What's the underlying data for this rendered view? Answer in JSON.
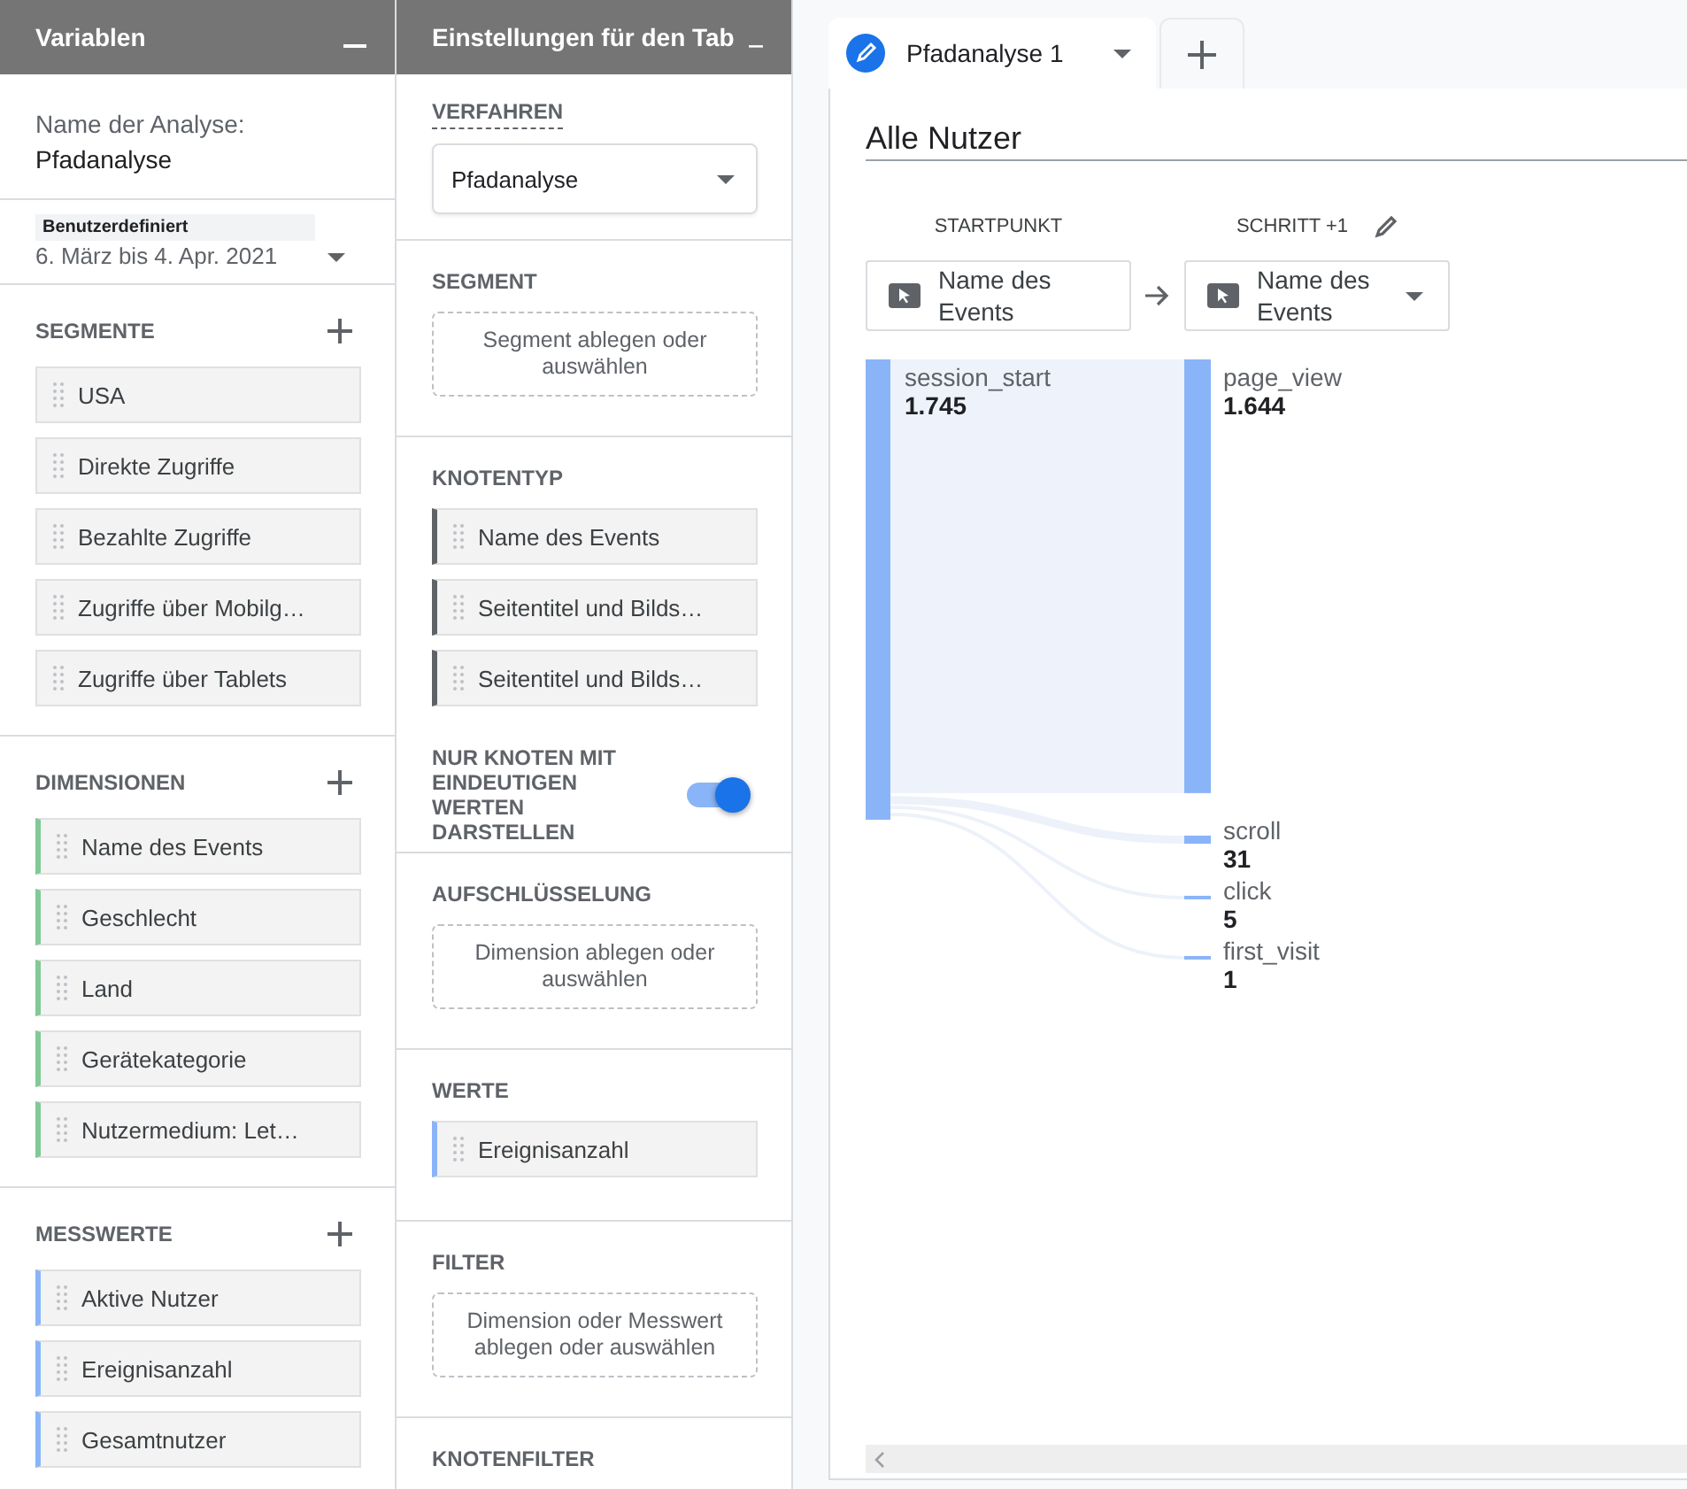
{
  "variables_panel": {
    "title": "Variablen",
    "analysis_name_label": "Name der Analyse:",
    "analysis_name": "Pfadanalyse",
    "date_range": {
      "label": "Benutzerdefiniert",
      "value": "6. März bis 4. Apr. 2021"
    },
    "segments": {
      "title": "SEGMENTE",
      "items": [
        "USA",
        "Direkte Zugriffe",
        "Bezahlte Zugriffe",
        "Zugriffe über Mobilg…",
        "Zugriffe über Tablets"
      ]
    },
    "dimensions": {
      "title": "DIMENSIONEN",
      "items": [
        "Name des Events",
        "Geschlecht",
        "Land",
        "Gerätekategorie",
        "Nutzermedium: Let…"
      ]
    },
    "metrics": {
      "title": "MESSWERTE",
      "items": [
        "Aktive Nutzer",
        "Ereignisanzahl",
        "Gesamtnutzer"
      ]
    }
  },
  "tab_settings_panel": {
    "title": "Einstellungen für den Tab",
    "technique": {
      "label": "VERFAHREN",
      "value": "Pfadanalyse"
    },
    "segment": {
      "label": "SEGMENT",
      "hint": "Segment ablegen oder auswählen"
    },
    "node_type": {
      "label": "KNOTENTYP",
      "items": [
        "Name des Events",
        "Seitentitel und Bilds…",
        "Seitentitel und Bilds…"
      ]
    },
    "unique_nodes": {
      "label": "NUR KNOTEN MIT EINDEUTIGEN WERTEN DARSTELLEN",
      "on": true
    },
    "breakdown": {
      "label": "AUFSCHLÜSSELUNG",
      "hint": "Dimension ablegen oder auswählen"
    },
    "values": {
      "label": "WERTE",
      "items": [
        "Ereignisanzahl"
      ]
    },
    "filter": {
      "label": "FILTER",
      "hint": "Dimension oder Messwert ablegen oder auswählen"
    },
    "node_filter": {
      "label": "KNOTENFILTER"
    }
  },
  "tabs": [
    {
      "label": "Pfadanalyse 1",
      "selected": true
    }
  ],
  "canvas": {
    "segment_title": "Alle Nutzer",
    "columns": [
      {
        "header": "STARTPUNKT",
        "selector": "Name des Events"
      },
      {
        "header": "SCHRITT +1",
        "selector": "Name des Events"
      }
    ],
    "start_nodes": [
      {
        "name": "session_start",
        "value": "1.745"
      }
    ],
    "step_nodes": [
      {
        "name": "page_view",
        "value": "1.644"
      },
      {
        "name": "scroll",
        "value": "31"
      },
      {
        "name": "click",
        "value": "5"
      },
      {
        "name": "first_visit",
        "value": "1"
      }
    ]
  }
}
